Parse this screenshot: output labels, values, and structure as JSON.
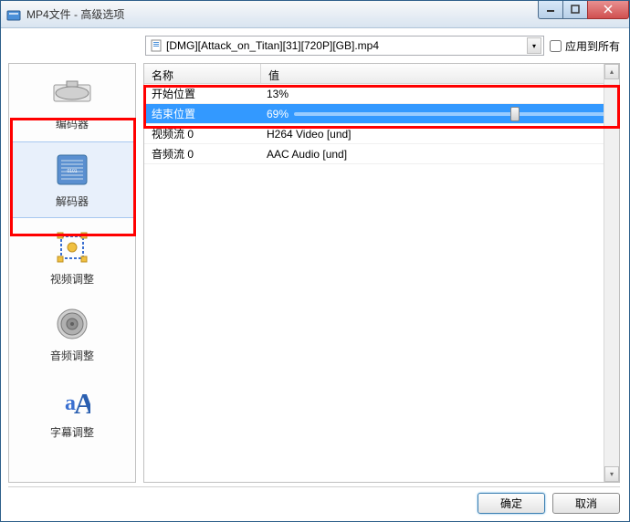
{
  "window": {
    "title": "MP4文件 - 高级选项"
  },
  "top": {
    "file_name": "[DMG][Attack_on_Titan][31][720P][GB].mp4",
    "apply_all_label": "应用到所有"
  },
  "sidebar": {
    "items": [
      {
        "label": "编码器",
        "icon": "encoder"
      },
      {
        "label": "解码器",
        "icon": "decoder"
      },
      {
        "label": "视频调整",
        "icon": "video"
      },
      {
        "label": "音频调整",
        "icon": "audio"
      },
      {
        "label": "字幕调整",
        "icon": "subtitle"
      }
    ],
    "selected_index": 1
  },
  "table": {
    "header_name": "名称",
    "header_value": "值",
    "rows": [
      {
        "name": "开始位置",
        "value": "13%",
        "type": "text"
      },
      {
        "name": "结束位置",
        "value": "69%",
        "type": "slider",
        "percent": 69,
        "selected": true
      },
      {
        "name": "视频流 0",
        "value": "H264 Video [und]",
        "type": "text"
      },
      {
        "name": "音频流 0",
        "value": "AAC Audio [und]",
        "type": "text"
      }
    ]
  },
  "buttons": {
    "ok": "确定",
    "cancel": "取消"
  }
}
